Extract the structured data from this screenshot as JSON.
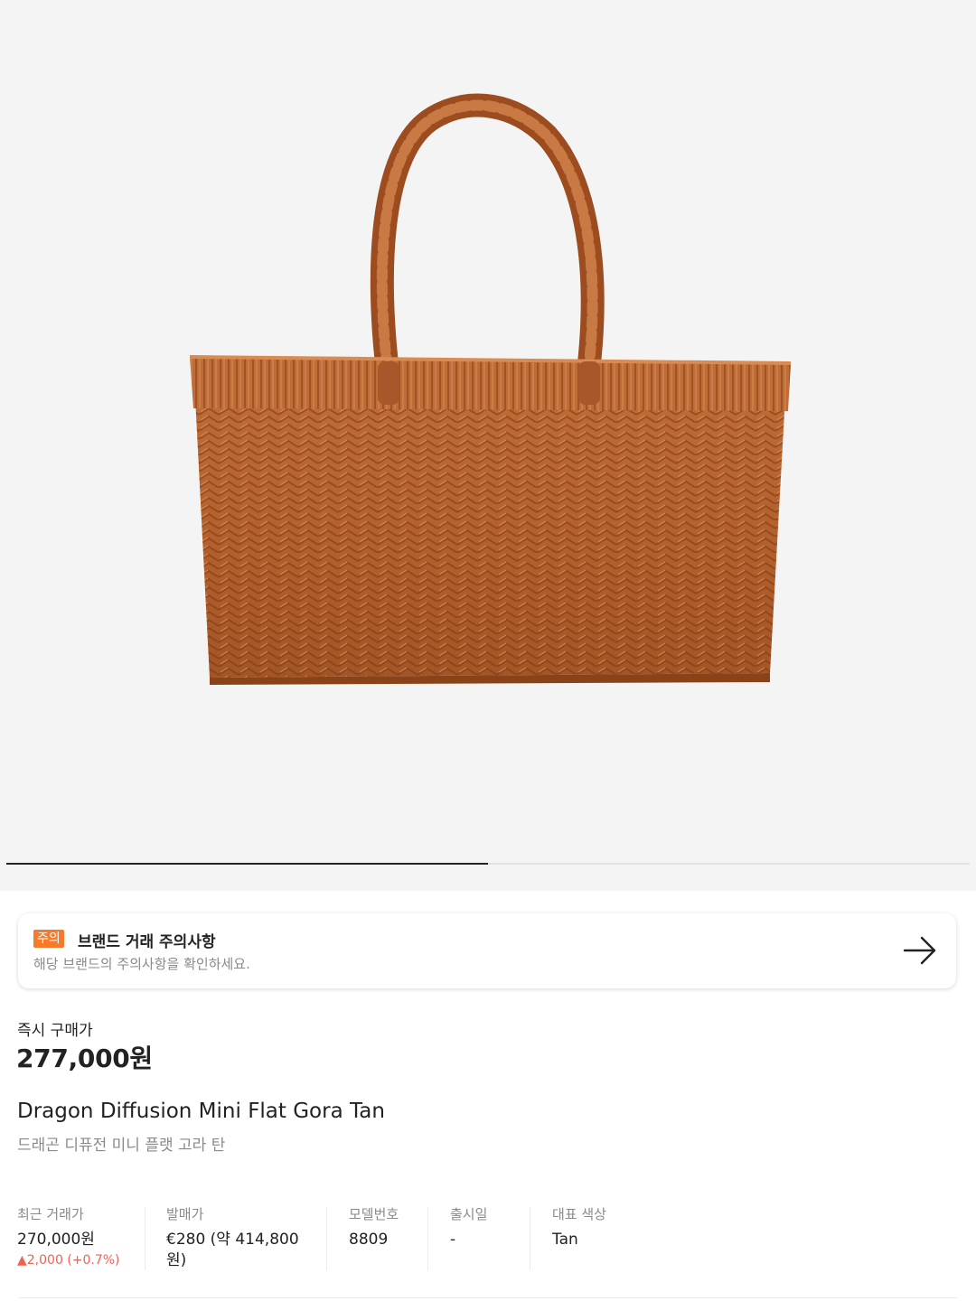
{
  "notice": {
    "badge": "주의",
    "title": "브랜드 거래 주의사항",
    "subtitle": "해당 브랜드의 주의사항을 확인하세요."
  },
  "price": {
    "label": "즉시 구매가",
    "value": "277,000원"
  },
  "product": {
    "name_en": "Dragon Diffusion Mini Flat Gora Tan",
    "name_ko": "드래곤 디퓨전 미니 플랫 고라 탄"
  },
  "image_carousel": {
    "progress_fraction": 0.5
  },
  "info": {
    "recent": {
      "label": "최근 거래가",
      "value": "270,000원",
      "change": "▲2,000 (+0.7%)"
    },
    "release_price": {
      "label": "발매가",
      "value_line1": "€280 (약 414,800",
      "value_line2": "원)"
    },
    "model": {
      "label": "모델번호",
      "value": "8809"
    },
    "release_date": {
      "label": "출시일",
      "value": "-"
    },
    "color": {
      "label": "대표 색상",
      "value": "Tan"
    }
  },
  "colors": {
    "badge": "#f57b2a",
    "price_up": "#ef6253",
    "basket": "#b4612e"
  },
  "icons": {
    "notice_arrow": "arrow-right-icon"
  }
}
